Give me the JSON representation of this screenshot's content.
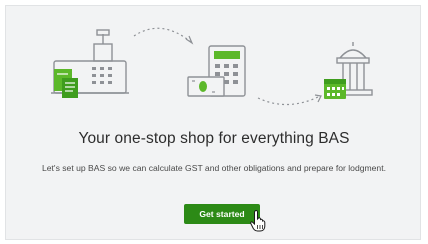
{
  "onboarding": {
    "title": "Your one-stop shop for everything BAS",
    "description": "Let's set up BAS so we can calculate GST and other obligations and prepare for lodgment.",
    "cta_label": "Get started"
  },
  "icons": [
    "cash-register-icon",
    "receipt-icon",
    "calculator-icon",
    "cash-icon",
    "calendar-icon",
    "government-building-icon",
    "dashed-arrow-icon",
    "hand-cursor-icon"
  ],
  "colors": {
    "accent": "#2c8a16",
    "icon_green": "#5cb82a",
    "icon_outline": "#8e9196",
    "background": "#f2f3f4"
  }
}
